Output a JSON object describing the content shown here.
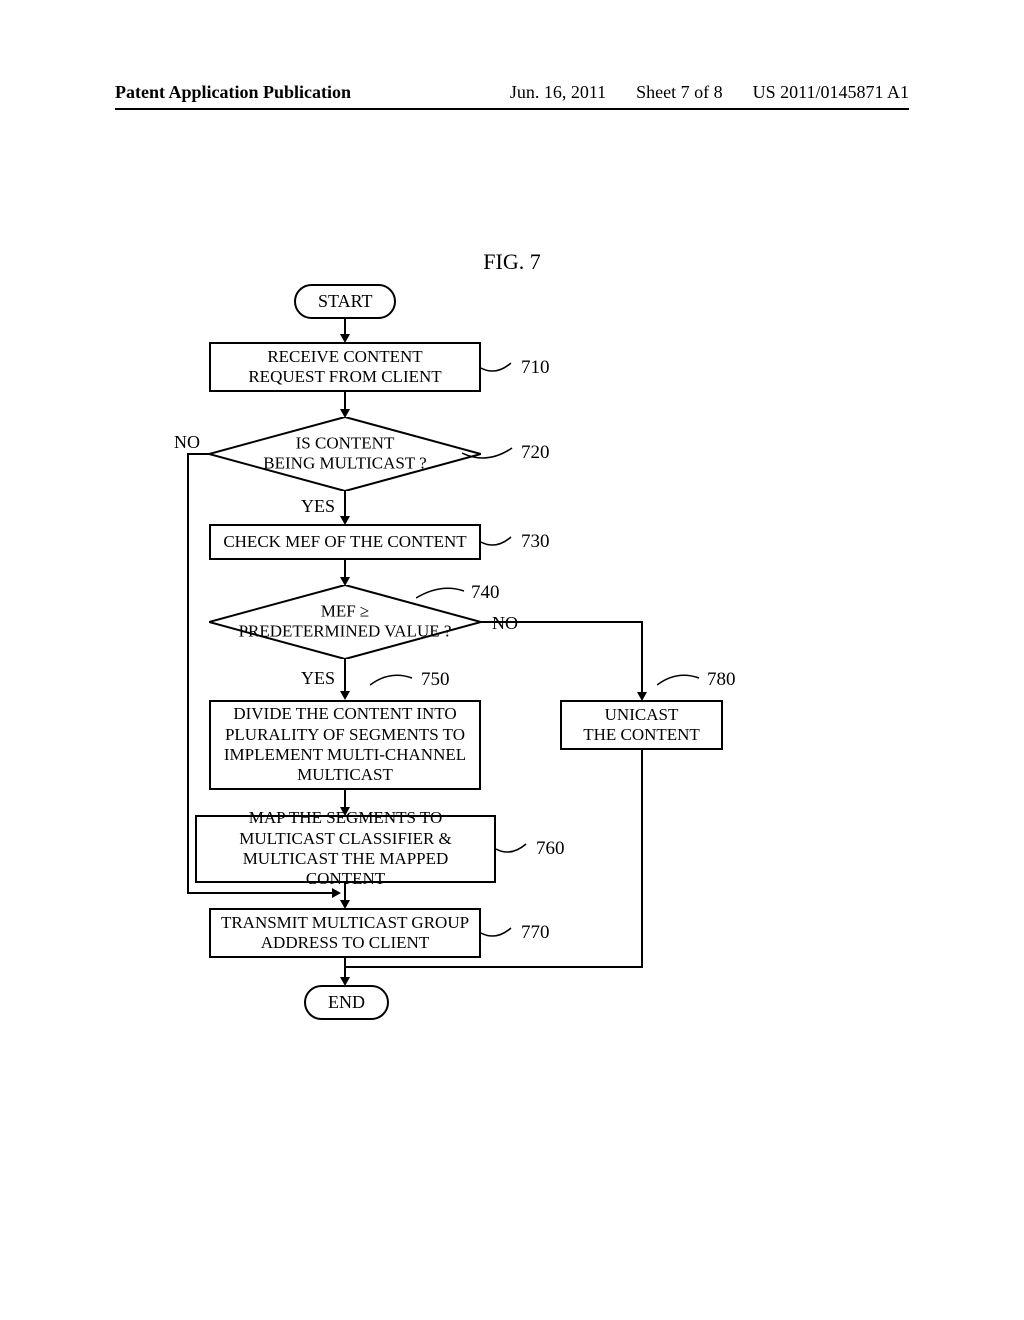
{
  "header": {
    "left": "Patent Application Publication",
    "date": "Jun. 16, 2011",
    "sheet": "Sheet 7 of 8",
    "pubno": "US 2011/0145871 A1"
  },
  "figure": {
    "title": "FIG. 7"
  },
  "nodes": {
    "start": "START",
    "end": "END",
    "n710": "RECEIVE CONTENT\nREQUEST FROM CLIENT",
    "n720": "IS CONTENT\nBEING MULTICAST ?",
    "n730": "CHECK MEF OF THE CONTENT",
    "n740": "MEF ≥\nPREDETERMINED VALUE ?",
    "n750": "DIVIDE THE CONTENT INTO\nPLURALITY OF SEGMENTS TO\nIMPLEMENT MULTI-CHANNEL\nMULTICAST",
    "n760": "MAP THE SEGMENTS TO\nMULTICAST CLASSIFIER &\nMULTICAST THE MAPPED CONTENT",
    "n770": "TRANSMIT MULTICAST GROUP\nADDRESS TO CLIENT",
    "n780": "UNICAST\nTHE CONTENT"
  },
  "refs": {
    "r710": "710",
    "r720": "720",
    "r730": "730",
    "r740": "740",
    "r750": "750",
    "r760": "760",
    "r770": "770",
    "r780": "780"
  },
  "labels": {
    "yes": "YES",
    "no": "NO"
  },
  "chart_data": {
    "type": "flowchart",
    "title": "FIG. 7",
    "nodes": [
      {
        "id": "start",
        "type": "terminator",
        "label": "START"
      },
      {
        "id": "710",
        "type": "process",
        "label": "RECEIVE CONTENT REQUEST FROM CLIENT"
      },
      {
        "id": "720",
        "type": "decision",
        "label": "IS CONTENT BEING MULTICAST ?"
      },
      {
        "id": "730",
        "type": "process",
        "label": "CHECK MEF OF THE CONTENT"
      },
      {
        "id": "740",
        "type": "decision",
        "label": "MEF ≥ PREDETERMINED VALUE ?"
      },
      {
        "id": "750",
        "type": "process",
        "label": "DIVIDE THE CONTENT INTO PLURALITY OF SEGMENTS TO IMPLEMENT MULTI-CHANNEL MULTICAST"
      },
      {
        "id": "760",
        "type": "process",
        "label": "MAP THE SEGMENTS TO MULTICAST CLASSIFIER & MULTICAST THE MAPPED CONTENT"
      },
      {
        "id": "770",
        "type": "process",
        "label": "TRANSMIT MULTICAST GROUP ADDRESS TO CLIENT"
      },
      {
        "id": "780",
        "type": "process",
        "label": "UNICAST THE CONTENT"
      },
      {
        "id": "end",
        "type": "terminator",
        "label": "END"
      }
    ],
    "edges": [
      {
        "from": "start",
        "to": "710"
      },
      {
        "from": "710",
        "to": "720"
      },
      {
        "from": "720",
        "to": "730",
        "label": "YES"
      },
      {
        "from": "720",
        "to": "770",
        "label": "NO"
      },
      {
        "from": "730",
        "to": "740"
      },
      {
        "from": "740",
        "to": "750",
        "label": "YES"
      },
      {
        "from": "740",
        "to": "780",
        "label": "NO"
      },
      {
        "from": "750",
        "to": "760"
      },
      {
        "from": "760",
        "to": "770"
      },
      {
        "from": "770",
        "to": "end"
      },
      {
        "from": "780",
        "to": "end"
      }
    ]
  }
}
